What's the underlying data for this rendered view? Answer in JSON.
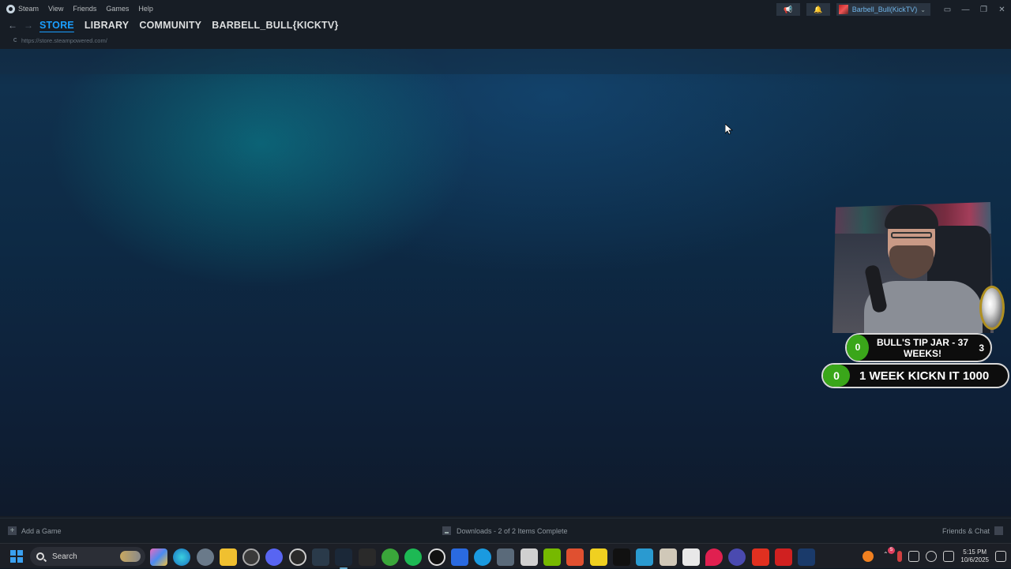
{
  "menubar": {
    "app_name": "Steam",
    "items": [
      "View",
      "Friends",
      "Games",
      "Help"
    ]
  },
  "account": {
    "name": "Barbell_Bull(KickTV)"
  },
  "nav": {
    "links": [
      "STORE",
      "LIBRARY",
      "COMMUNITY",
      "BARBELL_BULL{KICKTV}"
    ],
    "active": "STORE"
  },
  "url": "https://store.steampowered.com/",
  "bottombar": {
    "add_game": "Add a Game",
    "downloads": "Downloads - 2 of 2 Items Complete",
    "friends_chat": "Friends & Chat"
  },
  "overlay": {
    "tip_left": "0",
    "tip_text": "BULL'S TIP JAR - 37 WEEKS!",
    "tip_right": "3",
    "goal_left": "0",
    "goal_text": "1 WEEK KICKN IT 1000"
  },
  "taskbar": {
    "search_label": "Search",
    "time": "5:15 PM",
    "date": "10/6/2025",
    "notification_count": "5"
  },
  "colors": {
    "accent": "#1a9fff",
    "green": "#3aa61a"
  }
}
